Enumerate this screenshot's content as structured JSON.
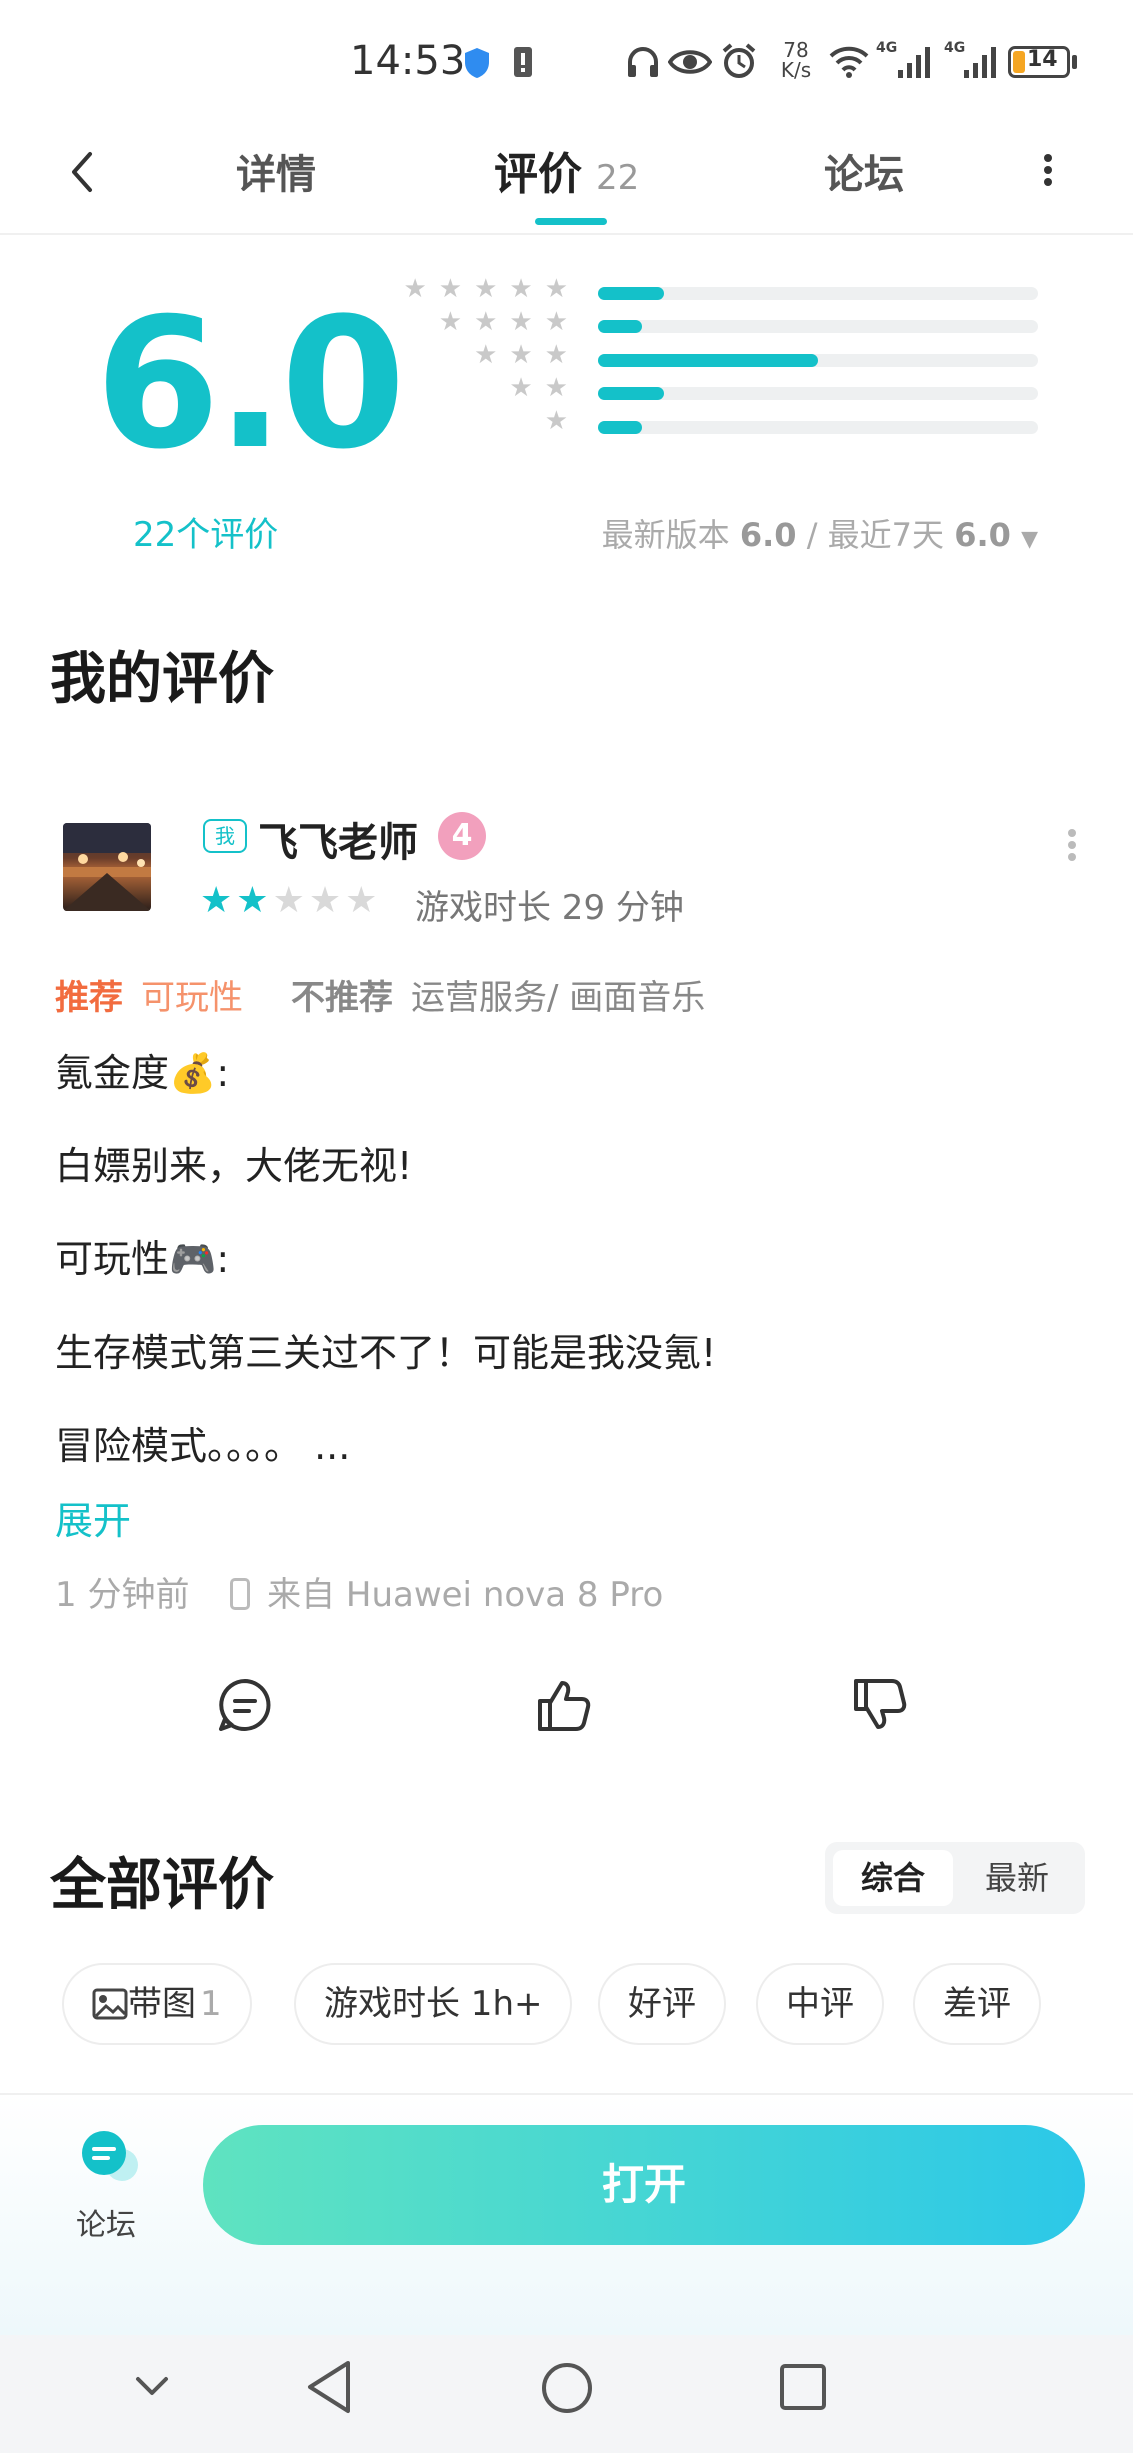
{
  "status_bar": {
    "time": "14:53",
    "net_speed_value": "78",
    "net_speed_unit": "K/s",
    "signal1_label": "4G",
    "signal2_label": "4G",
    "battery": "14"
  },
  "nav": {
    "tabs": [
      {
        "label": "详情"
      },
      {
        "label": "评价",
        "count": "22",
        "active": true
      },
      {
        "label": "论坛"
      }
    ]
  },
  "rating": {
    "score": "6.0",
    "count_label": "22个评价",
    "distribution": [
      {
        "stars": 5,
        "fraction": 0.15
      },
      {
        "stars": 4,
        "fraction": 0.1
      },
      {
        "stars": 3,
        "fraction": 0.5
      },
      {
        "stars": 2,
        "fraction": 0.15
      },
      {
        "stars": 1,
        "fraction": 0.1
      }
    ],
    "latest_version_label": "最新版本",
    "latest_version_score": "6.0",
    "separator": "/",
    "recent_label": "最近7天",
    "recent_score": "6.0"
  },
  "my_review": {
    "heading": "我的评价",
    "me_badge": "我",
    "username": "飞飞老师",
    "level": "4",
    "stars_filled": 2,
    "stars_total": 5,
    "playtime": "游戏时长 29 分钟",
    "recommend_label": "推荐",
    "recommend_value": "可玩性",
    "not_recommend_label": "不推荐",
    "not_recommend_value": "运营服务/ 画面音乐",
    "paragraphs": [
      "氪金度💰:",
      "白嫖别来，大佬无视!",
      "可玩性🎮:",
      "生存模式第三关过不了！可能是我没氪!",
      "冒险模式。。。。 ..."
    ],
    "expand_label": "展开",
    "time_ago": "1 分钟前",
    "device": "来自 Huawei nova 8 Pro"
  },
  "all_reviews": {
    "heading": "全部评价",
    "sort_options": [
      {
        "label": "综合",
        "selected": true
      },
      {
        "label": "最新",
        "selected": false
      }
    ],
    "filters": [
      {
        "label": "带图",
        "count": "1",
        "icon": "image-icon"
      },
      {
        "label": "游戏时长 1h+"
      },
      {
        "label": "好评"
      },
      {
        "label": "中评"
      },
      {
        "label": "差评"
      }
    ]
  },
  "bottom": {
    "forum_label": "论坛",
    "open_button": "打开"
  },
  "colors": {
    "accent": "#14c1c9",
    "recommend": "#f26c3f",
    "open_button_gradient_start": "#5fe3c0",
    "open_button_gradient_end": "#2cc8e8"
  }
}
